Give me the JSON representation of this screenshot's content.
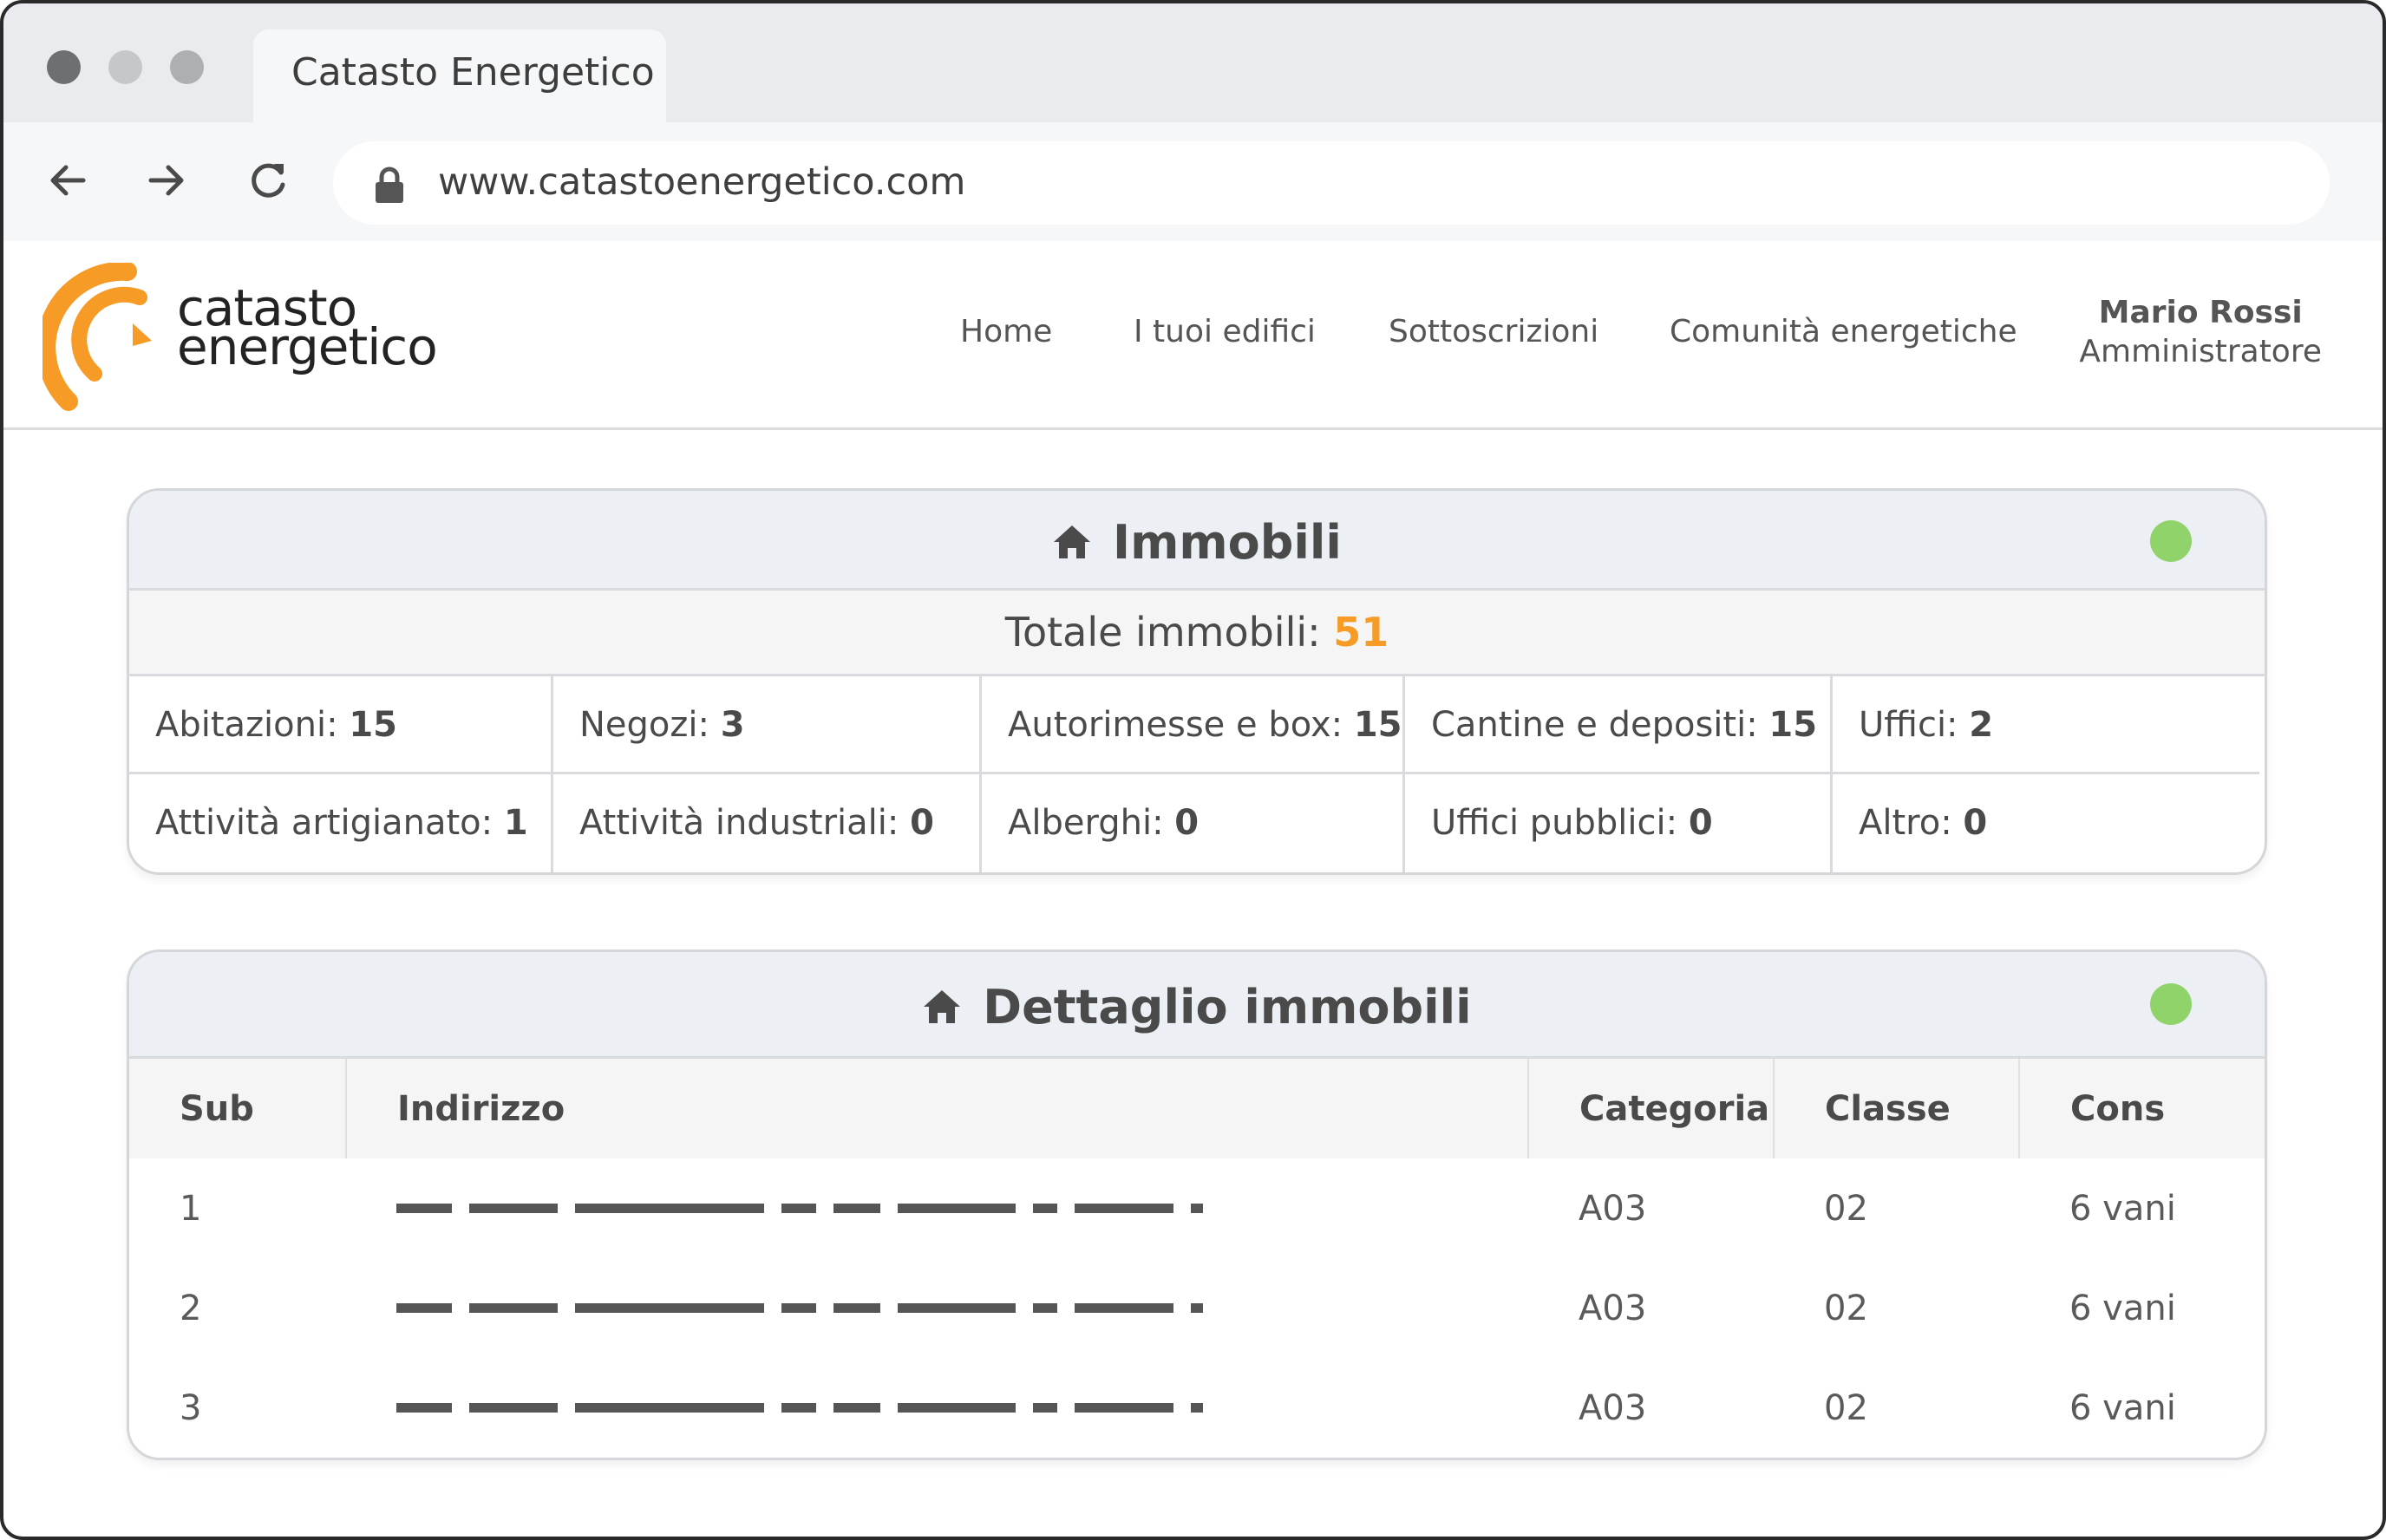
{
  "browser": {
    "tab_title": "Catasto Energetico",
    "url": "www.catastoenergetico.com"
  },
  "header": {
    "logo_line1": "catasto",
    "logo_line2": "energetico",
    "brand_color": "#f59b26",
    "menu": [
      "Home",
      "I tuoi edifici",
      "Sottoscrizioni",
      "Comunità energetiche"
    ],
    "user_name": "Mario Rossi",
    "user_role": "Amministratore"
  },
  "immobili": {
    "title": "Immobili",
    "status_color": "#8fd36a",
    "total_label": "Totale immobili: ",
    "total_value": "51",
    "counts": [
      {
        "label": "Abitazioni: ",
        "value": "15"
      },
      {
        "label": "Negozi: ",
        "value": "3"
      },
      {
        "label": "Autorimesse e box: ",
        "value": "15"
      },
      {
        "label": "Cantine e depositi: ",
        "value": "15"
      },
      {
        "label": "Uffici: ",
        "value": "2"
      },
      {
        "label": "Attività artigianato: ",
        "value": "1"
      },
      {
        "label": "Attività industriali: ",
        "value": "0"
      },
      {
        "label": "Alberghi: ",
        "value": "0"
      },
      {
        "label": "Uffici pubblici: ",
        "value": "0"
      },
      {
        "label": "Altro: ",
        "value": "0"
      }
    ]
  },
  "dettaglio": {
    "title": "Dettaglio immobili",
    "status_color": "#8fd36a",
    "columns": [
      "Sub",
      "Indirizzo",
      "Categoria",
      "Classe",
      "Cons"
    ],
    "rows": [
      {
        "sub": "1",
        "categoria": "A03",
        "classe": "02",
        "cons": "6 vani"
      },
      {
        "sub": "2",
        "categoria": "A03",
        "classe": "02",
        "cons": "6 vani"
      },
      {
        "sub": "3",
        "categoria": "A03",
        "classe": "02",
        "cons": "6 vani"
      }
    ]
  }
}
